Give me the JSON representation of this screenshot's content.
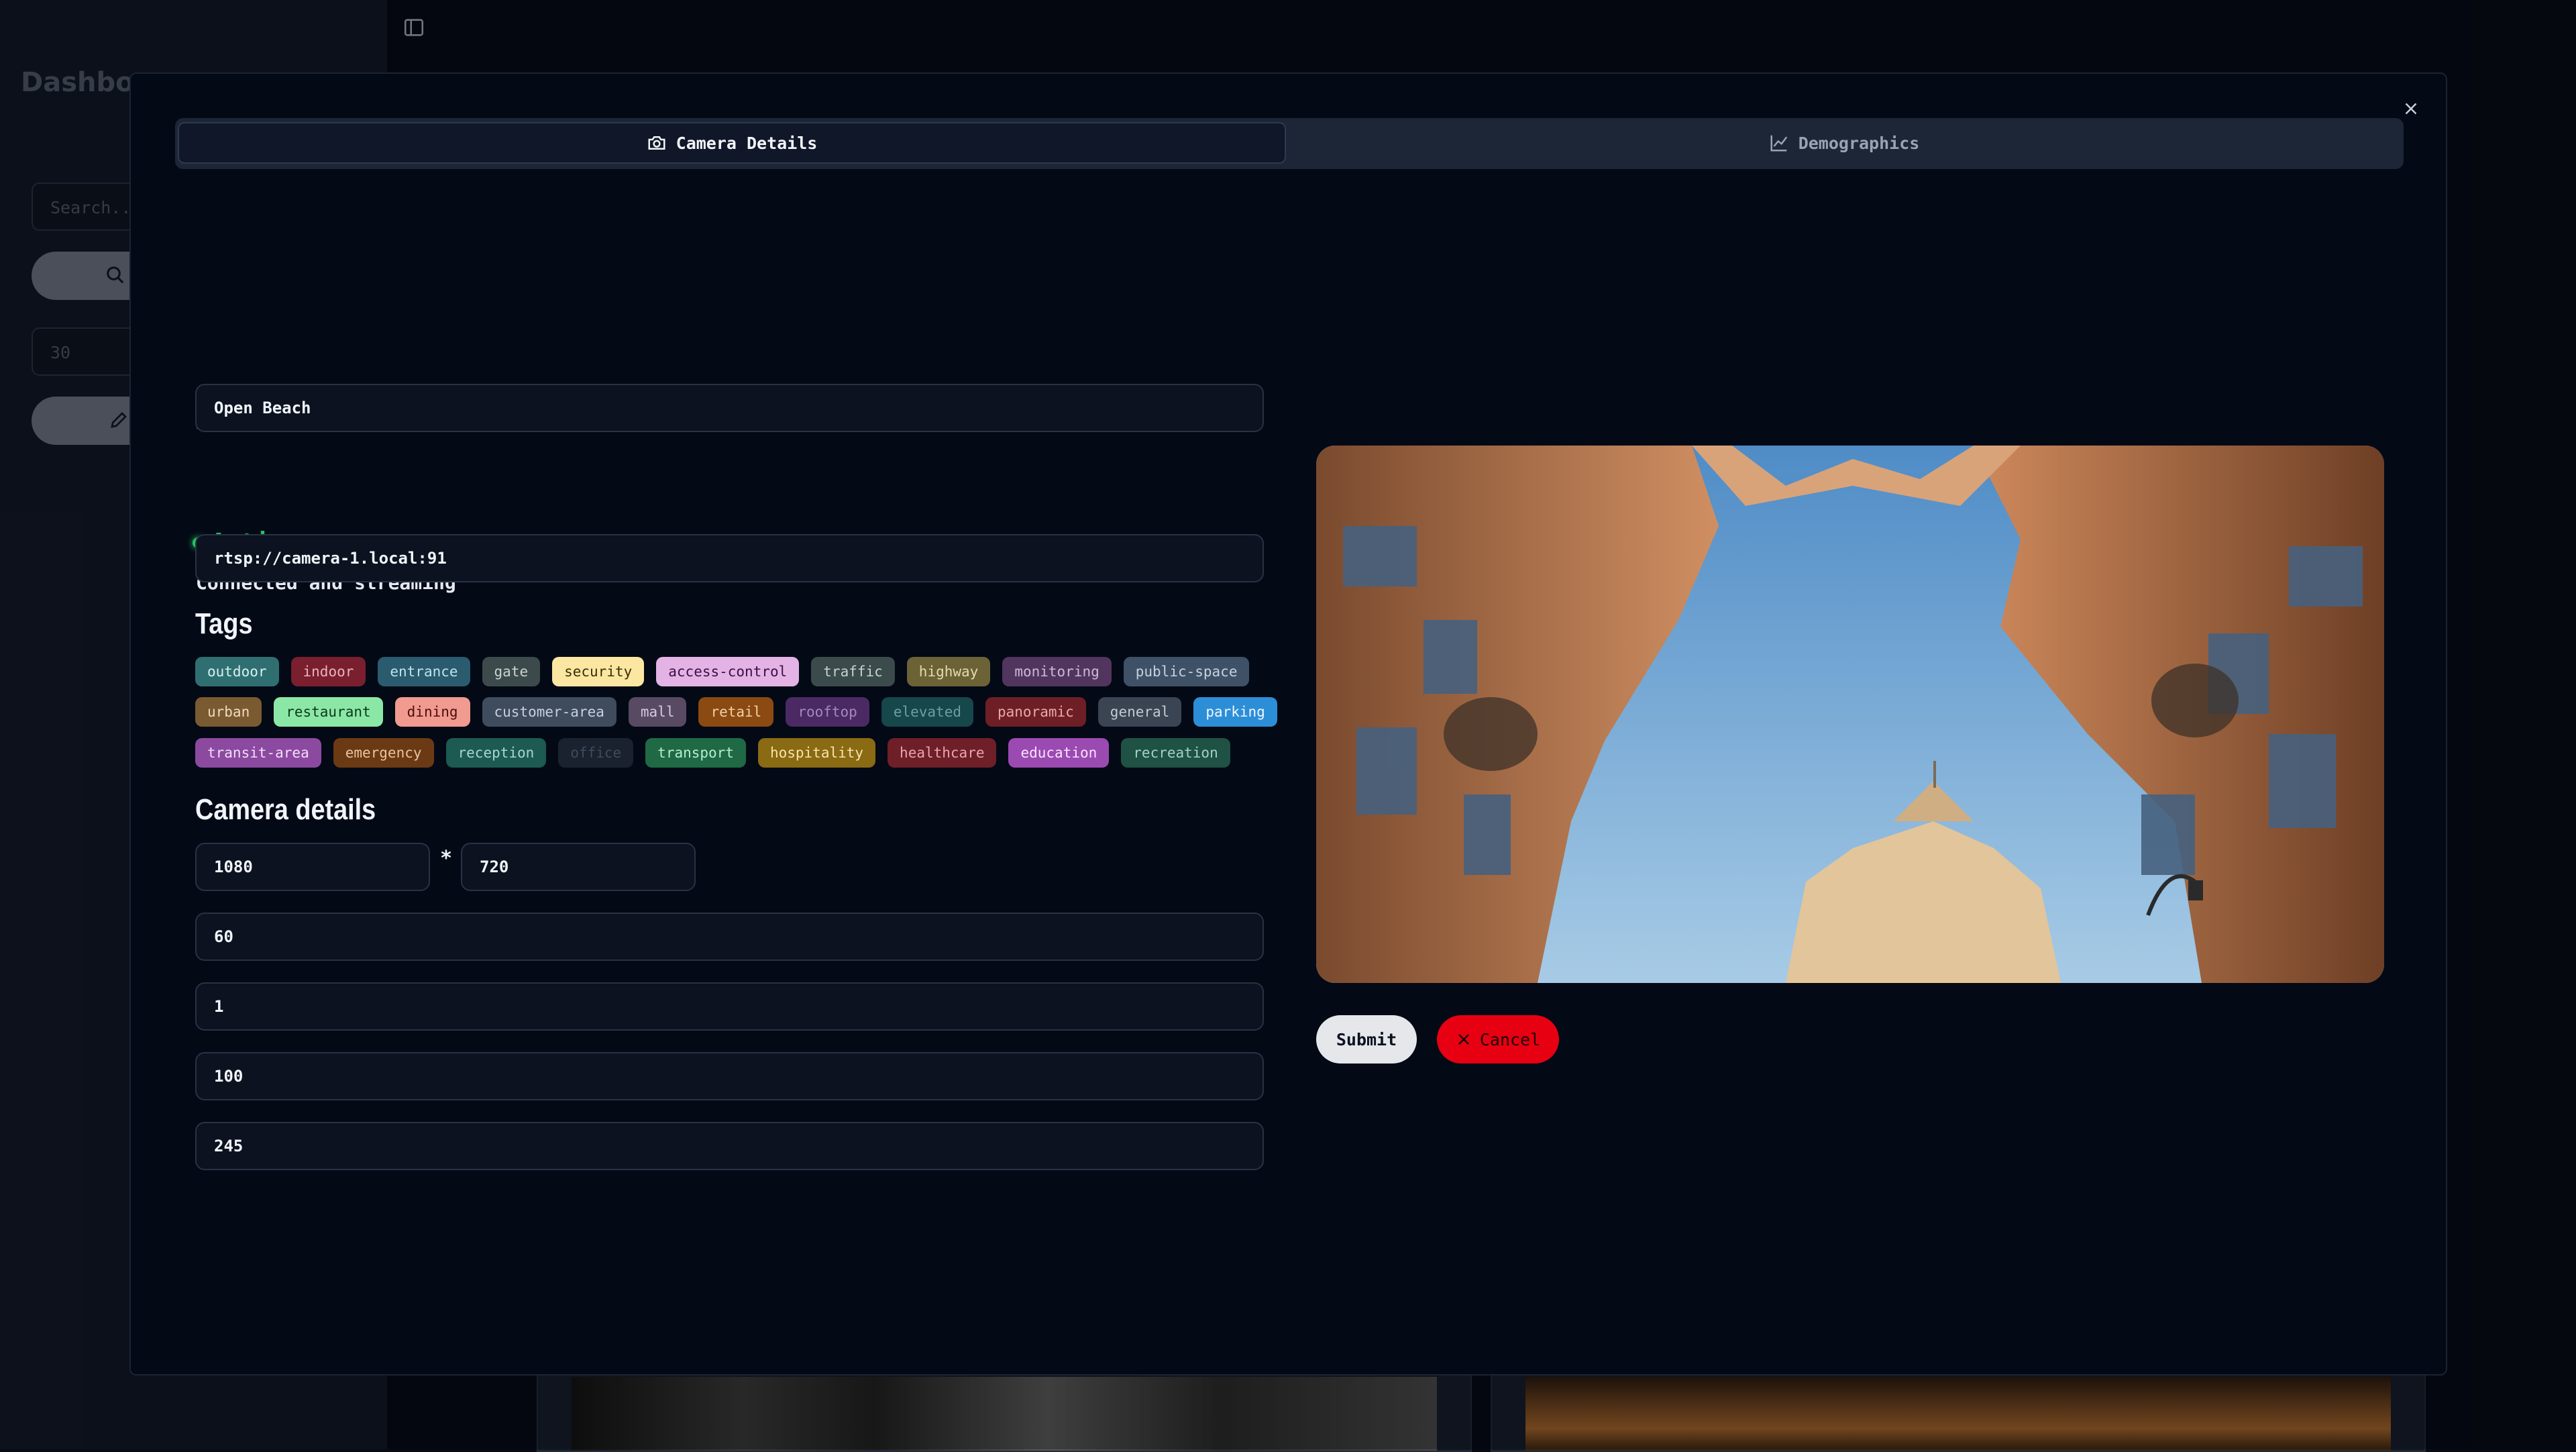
{
  "background": {
    "title": "Dashboa",
    "search_placeholder": "Search...",
    "limit_value": "30"
  },
  "tabs": [
    {
      "label": "Camera Details",
      "icon": "camera-icon",
      "active": true
    },
    {
      "label": "Demographics",
      "icon": "chart-line-icon",
      "active": false
    }
  ],
  "camera": {
    "id": "be4a5cba-3695-4180-98c2-2153c740d1e6",
    "name": "Open Beach",
    "status": "Active",
    "status_detail": "Connected and streaming",
    "stream_url": "rtsp://camera-1.local:91"
  },
  "tags_heading": "Tags",
  "tag_rows": [
    [
      {
        "label": "outdoor",
        "bg": "#2f6f72",
        "fg": "#d8f1f0"
      },
      {
        "label": "indoor",
        "bg": "#7a1f2e",
        "fg": "#e8b4bc"
      },
      {
        "label": "entrance",
        "bg": "#2a5b6e",
        "fg": "#bfe2ee"
      },
      {
        "label": "gate",
        "bg": "#3d4a4c",
        "fg": "#c9d3d2"
      },
      {
        "label": "security",
        "bg": "#fbe7a1",
        "fg": "#3a2e05"
      },
      {
        "label": "access-control",
        "bg": "#e3b3e6",
        "fg": "#3d0f41"
      },
      {
        "label": "traffic",
        "bg": "#3b4a4a",
        "fg": "#c3d4d2"
      },
      {
        "label": "highway",
        "bg": "#6b6236",
        "fg": "#e2dbb0"
      },
      {
        "label": "monitoring",
        "bg": "#51355e",
        "fg": "#cdb8d6"
      },
      {
        "label": "public-space",
        "bg": "#3f5166",
        "fg": "#c4d2e2"
      }
    ],
    [
      {
        "label": "urban",
        "bg": "#7a5a31",
        "fg": "#efdcbf"
      },
      {
        "label": "restaurant",
        "bg": "#8be7a6",
        "fg": "#0a3a1a"
      },
      {
        "label": "dining",
        "bg": "#f19a8f",
        "fg": "#4a0f0a"
      },
      {
        "label": "customer-area",
        "bg": "#3e4c5e",
        "fg": "#c7d1de"
      },
      {
        "label": "mall",
        "bg": "#584a63",
        "fg": "#d5c9de"
      },
      {
        "label": "retail",
        "bg": "#8a4a12",
        "fg": "#f3cfa4"
      },
      {
        "label": "rooftop",
        "bg": "#4b2a64",
        "fg": "#a58ab8"
      },
      {
        "label": "elevated",
        "bg": "#15474b",
        "fg": "#6f9fa1"
      },
      {
        "label": "panoramic",
        "bg": "#6e1f25",
        "fg": "#e6a9ad"
      },
      {
        "label": "general",
        "bg": "#3a4452",
        "fg": "#c2cad4"
      },
      {
        "label": "parking",
        "bg": "#2d8ed8",
        "fg": "#f0f7ff"
      }
    ],
    [
      {
        "label": "transit-area",
        "bg": "#8b4aa0",
        "fg": "#f4dcfb"
      },
      {
        "label": "emergency",
        "bg": "#6b3a14",
        "fg": "#e9c49f"
      },
      {
        "label": "reception",
        "bg": "#1c5a52",
        "fg": "#a7d8cf"
      },
      {
        "label": "office",
        "bg": "#1a2230",
        "fg": "#3f4a5b"
      },
      {
        "label": "transport",
        "bg": "#1f6a45",
        "fg": "#b7ecd0"
      },
      {
        "label": "hospitality",
        "bg": "#8a6a12",
        "fg": "#f7e4ad"
      },
      {
        "label": "healthcare",
        "bg": "#6e1f28",
        "fg": "#eaa6ae"
      },
      {
        "label": "education",
        "bg": "#9b4ab2",
        "fg": "#fbe3ff"
      },
      {
        "label": "recreation",
        "bg": "#1f5244",
        "fg": "#a2d3c3"
      }
    ]
  ],
  "details_heading": "Camera details",
  "details": {
    "width": "1080",
    "separator": "*",
    "height": "720",
    "fps": "60",
    "field_3": "1",
    "field_4": "100",
    "field_5": "245"
  },
  "actions": {
    "submit": "Submit",
    "cancel": "Cancel"
  }
}
